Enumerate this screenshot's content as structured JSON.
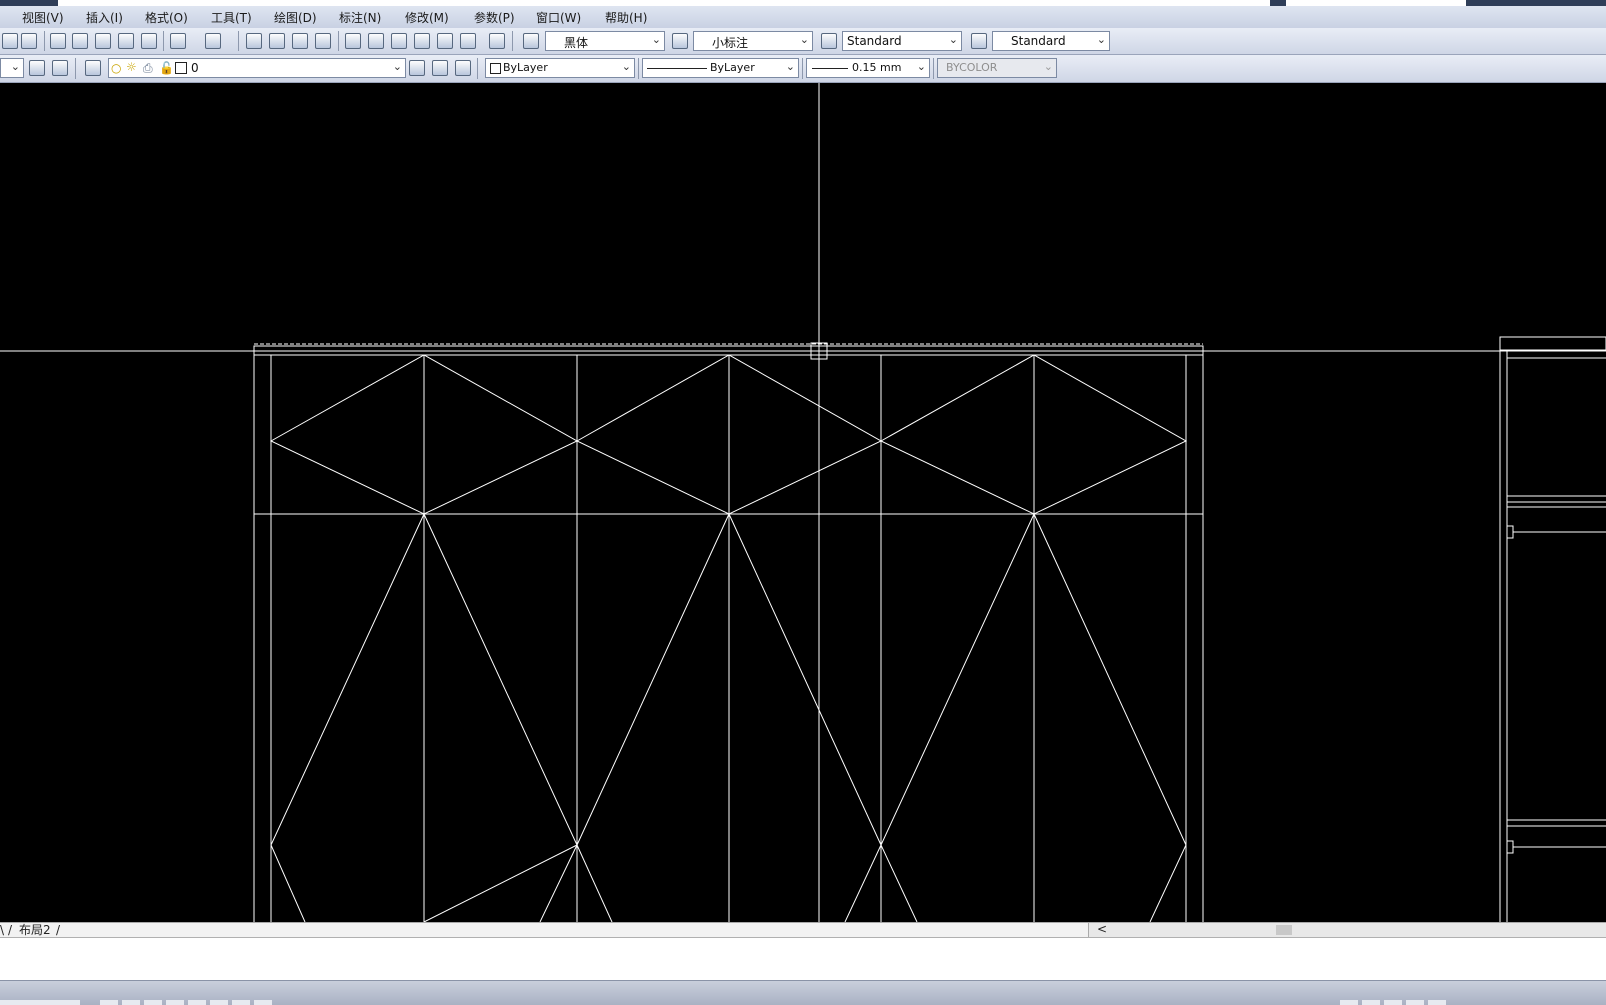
{
  "menubar": {
    "items": [
      {
        "label": "视图(V)"
      },
      {
        "label": "插入(I)"
      },
      {
        "label": "格式(O)"
      },
      {
        "label": "工具(T)"
      },
      {
        "label": "绘图(D)"
      },
      {
        "label": "标注(N)"
      },
      {
        "label": "修改(M)"
      },
      {
        "label": "参数(P)"
      },
      {
        "label": "窗口(W)"
      },
      {
        "label": "帮助(H)"
      }
    ]
  },
  "styles_toolbar": {
    "text_font": "黑体",
    "dim_style": "小标注",
    "table_style": "Standard",
    "multileader_style": "Standard"
  },
  "properties_toolbar": {
    "layer": "0",
    "color": "ByLayer",
    "linetype": "ByLayer",
    "lineweight": "0.15 mm",
    "plot_style": "BYCOLOR"
  },
  "layout_tabs": {
    "partial_tab": "\\",
    "layout2": "布局2"
  },
  "icons": {
    "toolbar1": [
      "new-icon",
      "open-icon",
      "cut-icon",
      "copy-icon",
      "paste-icon",
      "match-properties-icon",
      "block-editor-icon",
      "undo-icon",
      "redo-icon",
      "pan-icon",
      "zoom-realtime-icon",
      "zoom-window-icon",
      "zoom-previous-icon",
      "properties-icon",
      "design-center-icon",
      "tool-palettes-icon",
      "sheet-set-icon",
      "markup-icon",
      "calculator-icon",
      "help-icon",
      "text-style-icon",
      "dim-style-icon",
      "table-style-icon",
      "multileader-style-icon"
    ],
    "toolbar2": [
      "workspace-icon",
      "settings-icon",
      "layer-manager-icon",
      "layer-on-icon",
      "layer-freeze-icon",
      "layer-lock-icon",
      "make-current-icon",
      "layer-previous-icon",
      "layer-state-icon"
    ]
  },
  "colors": {
    "canvas_background": "#000000",
    "linework": "#ffffff",
    "toolbar_background": "#dce2ef"
  }
}
